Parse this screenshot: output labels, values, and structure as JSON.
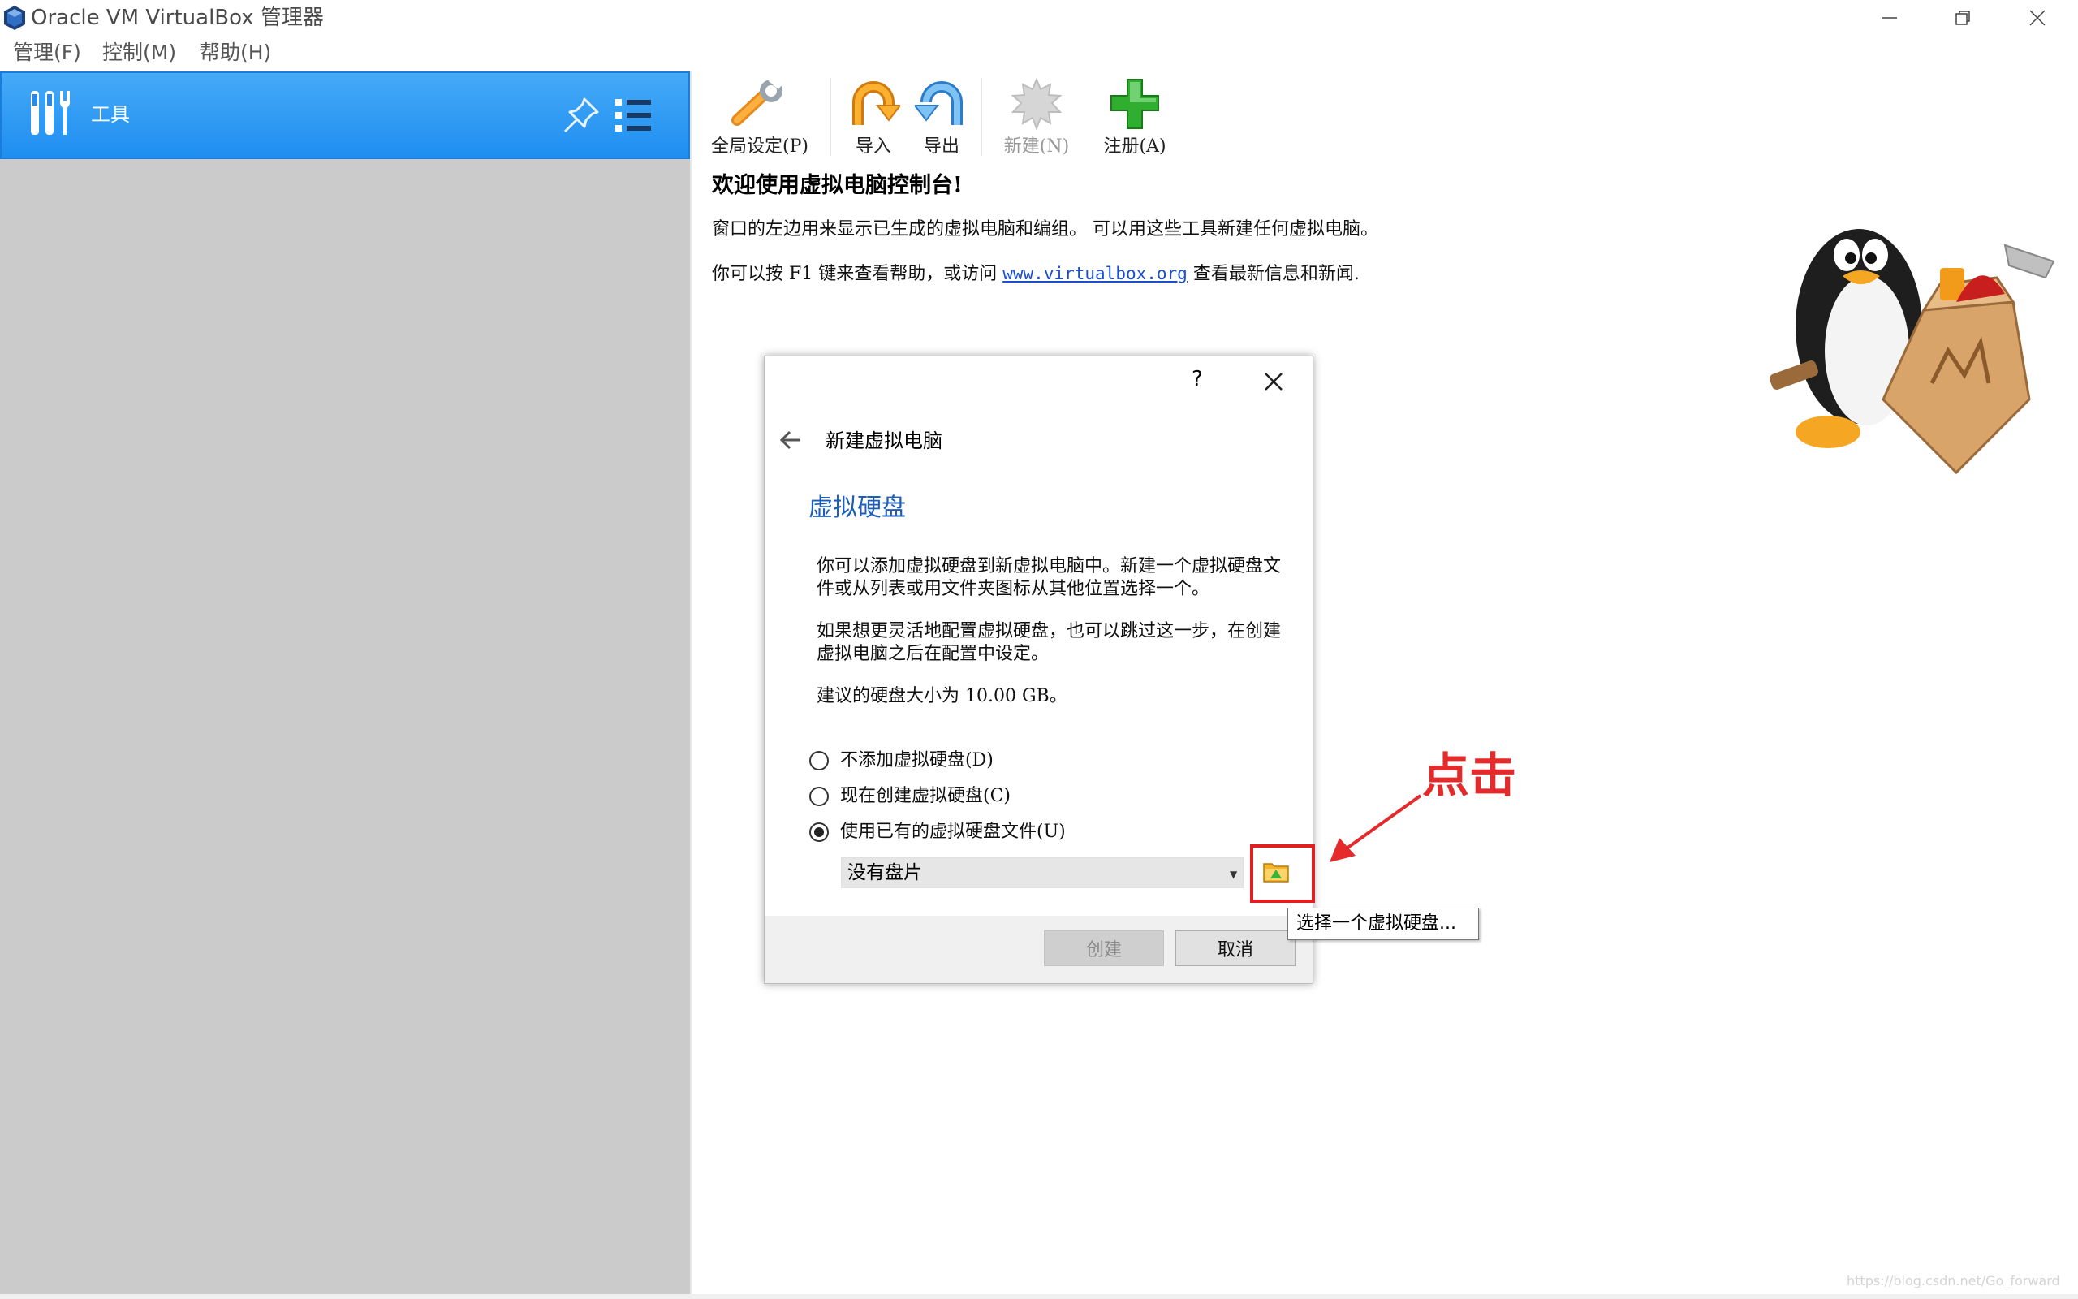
{
  "window": {
    "title": "Oracle VM VirtualBox 管理器",
    "controls": [
      "minimize-icon",
      "restore-icon",
      "close-icon"
    ]
  },
  "menubar": {
    "items": [
      "管理(F)",
      "控制(M)",
      "帮助(H)"
    ]
  },
  "sidebar": {
    "tools_label": "工具",
    "icons": [
      "tools-icon",
      "pin-icon",
      "list-menu-icon"
    ],
    "selected_color": "#2196f3"
  },
  "toolbar": {
    "buttons": [
      {
        "label": "全局设定(P)",
        "icon": "global-settings-icon",
        "enabled": true
      },
      {
        "label": "导入",
        "icon": "import-icon",
        "enabled": true
      },
      {
        "label": "导出",
        "icon": "export-icon",
        "enabled": true
      },
      {
        "label": "新建(N)",
        "icon": "new-icon",
        "enabled": false
      },
      {
        "label": "注册(A)",
        "icon": "register-icon",
        "enabled": true
      }
    ]
  },
  "welcome": {
    "title": "欢迎使用虚拟电脑控制台!",
    "line1": "窗口的左边用来显示已生成的虚拟电脑和编组。 可以用这些工具新建任何虚拟电脑。",
    "line2_prefix": "你可以按 F1 键来查看帮助，或访问 ",
    "line2_link": "www.virtualbox.org",
    "line2_suffix": " 查看最新信息和新闻."
  },
  "dialog": {
    "help_label": "?",
    "title": "新建虚拟电脑",
    "page_heading": "虚拟硬盘",
    "para1": "你可以添加虚拟硬盘到新虚拟电脑中。新建一个虚拟硬盘文件或从列表或用文件夹图标从其他位置选择一个。",
    "para2": "如果想更灵活地配置虚拟硬盘，也可以跳过这一步，在创建虚拟电脑之后在配置中设定。",
    "para3": "建议的硬盘大小为 10.00 GB。",
    "options": [
      {
        "label": "不添加虚拟硬盘(D)",
        "checked": false
      },
      {
        "label": "现在创建虚拟硬盘(C)",
        "checked": false
      },
      {
        "label": "使用已有的虚拟硬盘文件(U)",
        "checked": true
      }
    ],
    "disk_select_value": "没有盘片",
    "folder_tooltip": "选择一个虚拟硬盘...",
    "create_label": "创建",
    "cancel_label": "取消",
    "heading_color": "#1d5fb8"
  },
  "annotation": {
    "text": "点击",
    "color": "#e42a2a"
  },
  "watermark": "https://blog.csdn.net/Go_forward"
}
